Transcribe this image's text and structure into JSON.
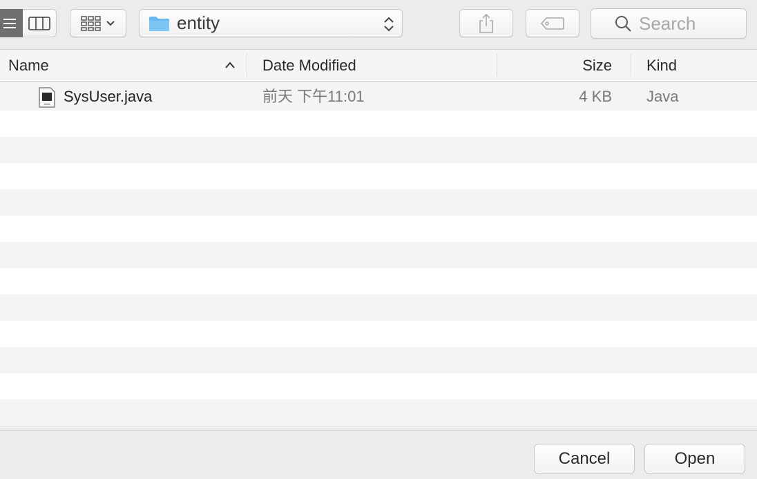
{
  "toolbar": {
    "view_list_icon": "list-view-icon",
    "view_columns_icon": "column-view-icon",
    "arrange_icon": "grid-arrange-icon",
    "path_folder": "entity",
    "share_icon": "share-icon",
    "tag_icon": "tag-icon",
    "search_placeholder": "Search"
  },
  "columns": {
    "name": "Name",
    "date_modified": "Date Modified",
    "size": "Size",
    "kind": "Kind"
  },
  "files": [
    {
      "name": "SysUser.java",
      "date_modified": "前天 下午11:01",
      "size": "4 KB",
      "kind": "Java",
      "icon": "java-file-icon"
    }
  ],
  "footer": {
    "cancel": "Cancel",
    "open": "Open"
  },
  "colors": {
    "window_bg": "#ececec",
    "row_alt": "#f4f4f4",
    "folder_blue": "#6ab8f0",
    "secondary_text": "#7a7a7a"
  }
}
